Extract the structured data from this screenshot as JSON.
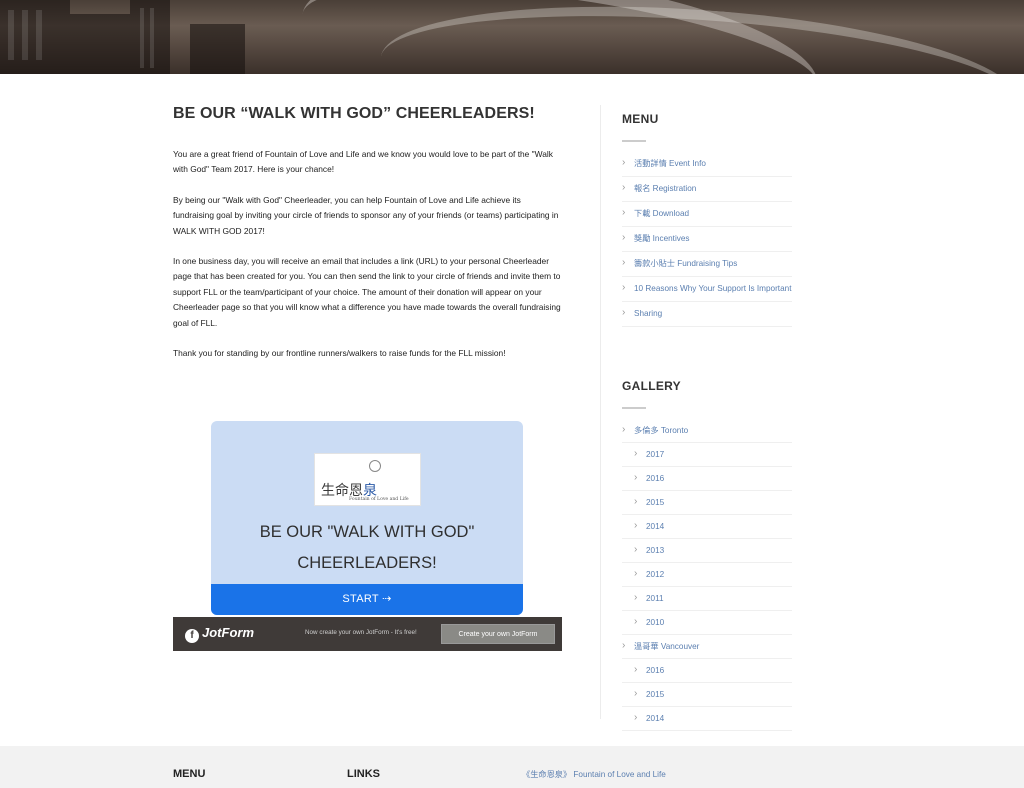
{
  "content": {
    "title": "BE OUR “WALK WITH GOD” CHEERLEADERS!",
    "paragraphs": [
      "You are a great friend of Fountain of Love and Life and we know you would love to be part of the \"Walk with God\" Team 2017. Here is your chance!",
      "By being our \"Walk with God\" Cheerleader, you can help Fountain of Love and Life achieve its fundraising goal by inviting your circle of friends to sponsor any of your friends (or teams) participating in WALK WITH GOD 2017!",
      "In one business day, you will receive an email that includes a link (URL) to your personal Cheerleader page that has been created for you. You can then send the link to your circle of friends and invite them to support FLL or the team/participant of your choice. The amount of their donation will appear on your Cheerleader page so that you will know what a difference you have made towards the overall fundraising goal of FLL.",
      "Thank you for standing by our frontline runners/walkers to raise funds for the FLL mission!"
    ]
  },
  "form": {
    "logo_cn_1": "生命恩",
    "logo_cn_2": "泉",
    "logo_en": "Fountain of Love and Life",
    "title_line1": "BE OUR \"WALK WITH GOD\"",
    "title_line2": "CHEERLEADERS!",
    "start_label": "START  ⇢",
    "bar_brand": "JotForm",
    "bar_brand_icon": "f",
    "bar_note": "Now create your own JotForm - It's free!",
    "bar_cta": "Create your own JotForm"
  },
  "sidebar": {
    "menu_heading": "MENU",
    "menu_items": [
      "活動詳情 Event Info",
      "報名 Registration",
      "下載 Download",
      "獎勵 Incentives",
      "籌款小貼士 Fundraising Tips",
      "10 Reasons Why Your Support Is Important",
      "Sharing"
    ],
    "gallery_heading": "GALLERY",
    "gallery": {
      "toronto": "多倫多 Toronto",
      "toronto_years": [
        "2017",
        "2016",
        "2015",
        "2014",
        "2013",
        "2012",
        "2011",
        "2010"
      ],
      "vancouver": "溫哥華 Vancouver",
      "vancouver_years": [
        "2016",
        "2015",
        "2014"
      ]
    }
  },
  "footer": {
    "menu_heading": "MENU",
    "links_heading": "LINKS",
    "link_text": "《生命恩泉》 Fountain of Love and Life"
  },
  "colors": {
    "link": "#5b7fb0",
    "start_button": "#1a73e8",
    "form_bg": "#cbdcf4",
    "jotform_bar": "#3f3a38"
  }
}
